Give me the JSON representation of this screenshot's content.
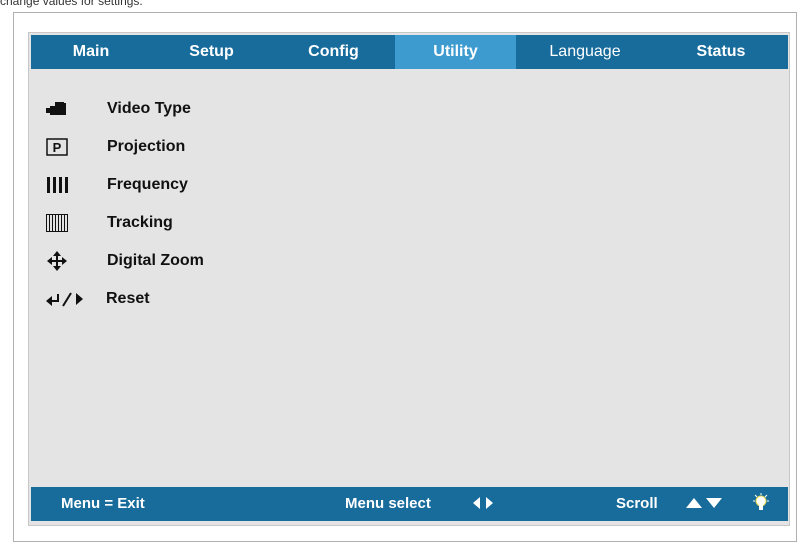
{
  "caption": "change values for settings.",
  "tabs": [
    {
      "label": "Main",
      "active": false
    },
    {
      "label": "Setup",
      "active": false
    },
    {
      "label": "Config",
      "active": false
    },
    {
      "label": "Utility",
      "active": true
    },
    {
      "label": "Language",
      "active": false
    },
    {
      "label": "Status",
      "active": false
    }
  ],
  "menu": [
    {
      "label": "Video Type",
      "icon": "video-camera-icon"
    },
    {
      "label": "Projection",
      "icon": "projection-p-icon"
    },
    {
      "label": "Frequency",
      "icon": "frequency-bars-icon"
    },
    {
      "label": "Tracking",
      "icon": "tracking-bars-icon"
    },
    {
      "label": "Digital Zoom",
      "icon": "move-arrows-icon"
    },
    {
      "label": "Reset",
      "icon": "reset-arrows-icon"
    }
  ],
  "footer": {
    "exit_label": "Menu = Exit",
    "select_label": "Menu select",
    "scroll_label": "Scroll"
  },
  "colors": {
    "bar": "#176c9c",
    "active_tab": "#3d9bd0",
    "panel": "#e4e4e4"
  }
}
